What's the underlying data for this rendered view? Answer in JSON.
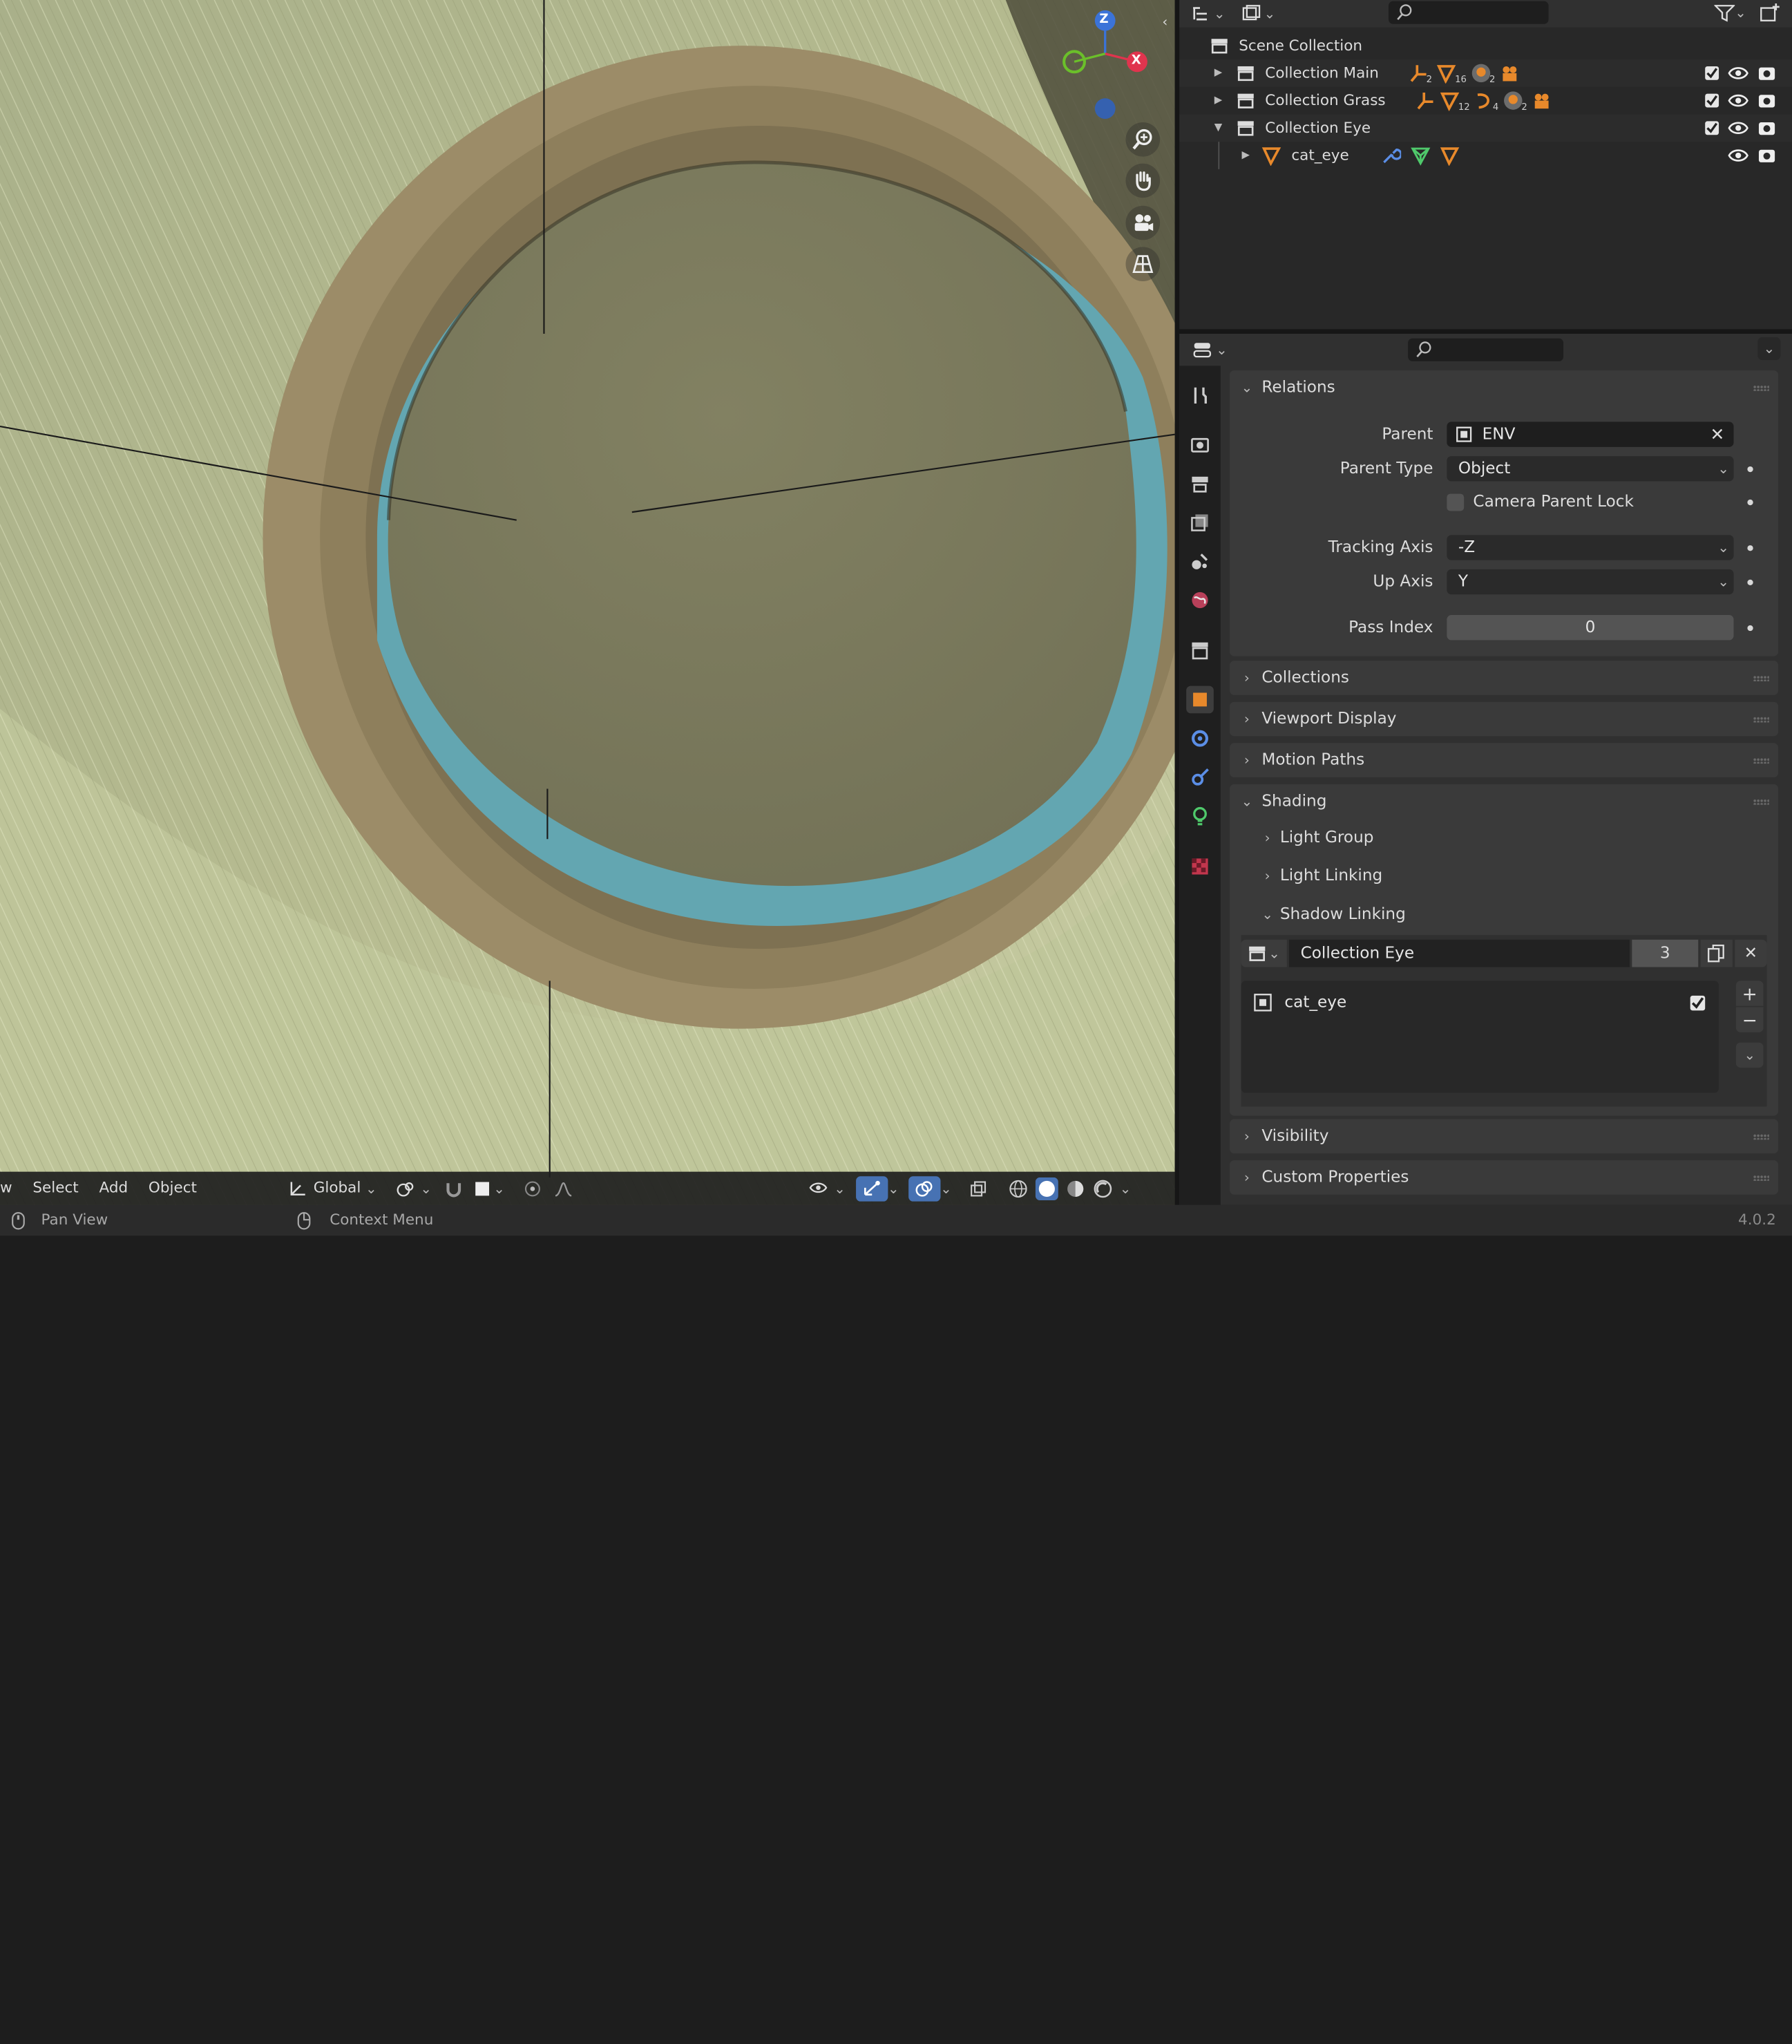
{
  "viewport": {
    "header_menu": [
      "w",
      "Select",
      "Add",
      "Object"
    ],
    "transform_orientation": "Global",
    "gizmo_axes": {
      "z": "Z",
      "x": "X"
    }
  },
  "statusbar": {
    "left_hint": "Pan View",
    "right_hint": "Context Menu",
    "version": "4.0.2"
  },
  "outliner": {
    "root": "Scene Collection",
    "rows": [
      {
        "label": "Collection Main",
        "expanded": false
      },
      {
        "label": "Collection Grass",
        "expanded": false
      },
      {
        "label": "Collection Eye",
        "expanded": true
      },
      {
        "label": "cat_eye",
        "expanded": false
      }
    ],
    "badges": {
      "main": [
        "2",
        "16",
        "2"
      ],
      "grass": [
        "12",
        "4",
        "2"
      ]
    }
  },
  "properties": {
    "relations": {
      "title": "Relations",
      "parent_label": "Parent",
      "parent_value": "ENV",
      "parent_type_label": "Parent Type",
      "parent_type_value": "Object",
      "camera_parent_lock": "Camera Parent Lock",
      "tracking_axis_label": "Tracking Axis",
      "tracking_axis_value": "-Z",
      "up_axis_label": "Up Axis",
      "up_axis_value": "Y",
      "pass_index_label": "Pass Index",
      "pass_index_value": "0"
    },
    "panels": {
      "collections": "Collections",
      "viewport_display": "Viewport Display",
      "motion_paths": "Motion Paths",
      "shading": "Shading",
      "light_group": "Light Group",
      "light_linking": "Light Linking",
      "shadow_linking": "Shadow Linking",
      "visibility": "Visibility",
      "custom_properties": "Custom Properties"
    },
    "shadow_linking": {
      "collection": "Collection Eye",
      "users": "3",
      "items": [
        "cat_eye"
      ]
    }
  },
  "colors": {
    "accent_orange": "#e8892b",
    "active_blue": "#4772b3",
    "fur": "#bcc497",
    "iris": "#7c7b5e",
    "rim": "#5fa5b0"
  }
}
